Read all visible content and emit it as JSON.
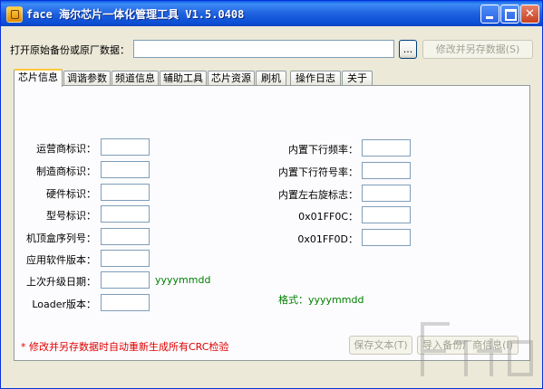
{
  "window": {
    "title": "face 海尔芯片一体化管理工具 V1.5.0408",
    "minimize_glyph": "",
    "maximize_glyph": "",
    "close_glyph": "✕"
  },
  "open_row": {
    "label": "打开原始备份或原厂数据：",
    "path_value": "",
    "browse_label": "...",
    "save_as_label": "修改并另存数据(S)"
  },
  "tabs": [
    {
      "label": "芯片信息"
    },
    {
      "label": "调谐参数"
    },
    {
      "label": "频道信息"
    },
    {
      "label": "辅助工具"
    },
    {
      "label": "芯片资源"
    },
    {
      "label": "刷机"
    },
    {
      "label": "操作日志"
    },
    {
      "label": "关于"
    }
  ],
  "left_fields": [
    {
      "label": "运营商标识：",
      "value": ""
    },
    {
      "label": "制造商标识：",
      "value": ""
    },
    {
      "label": "硬件标识：",
      "value": ""
    },
    {
      "label": "型号标识：",
      "value": ""
    },
    {
      "label": "机顶盒序列号：",
      "value": ""
    },
    {
      "label": "应用软件版本：",
      "value": ""
    },
    {
      "label": "上次升级日期：",
      "value": ""
    },
    {
      "label": "Loader版本：",
      "value": ""
    }
  ],
  "date_hint": "yyyymmdd",
  "right_fields": [
    {
      "label": "内置下行频率：",
      "value": ""
    },
    {
      "label": "内置下行符号率：",
      "value": ""
    },
    {
      "label": "内置左右旋标志：",
      "value": ""
    },
    {
      "label": "0x01FF0C：",
      "value": ""
    },
    {
      "label": "0x01FF0D：",
      "value": ""
    }
  ],
  "format_hint": "格式：yyyymmdd",
  "footer": {
    "note": "* 修改并另存数据时自动重新生成所有CRC检验",
    "save_text_label": "保存文本(T)",
    "import_label": "导入备份厂商信息(I)"
  },
  "colors": {
    "titlebar": "#0a5ce8",
    "dialog_bg": "#ece9d8",
    "hint_green": "#008000",
    "note_red": "#e00000",
    "active_tab_accent": "#ffc83c"
  }
}
